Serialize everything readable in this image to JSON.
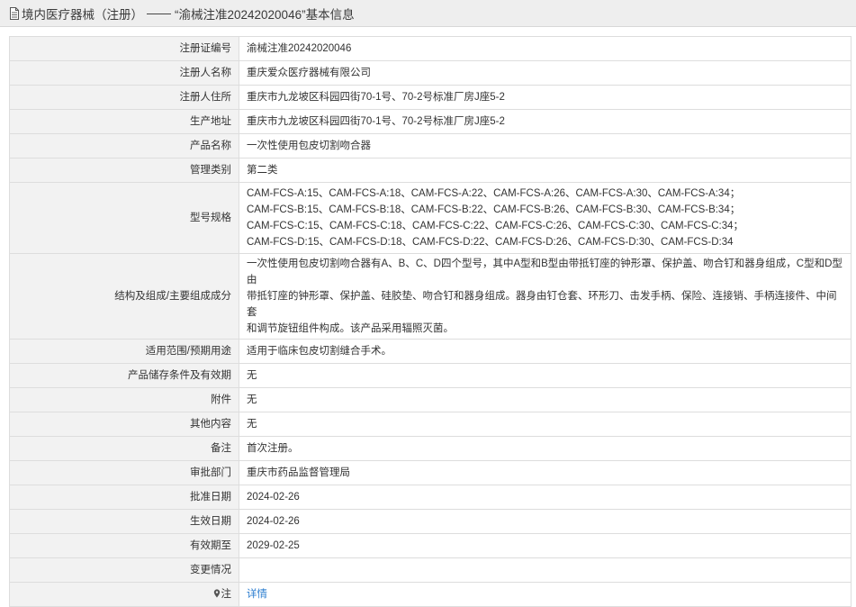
{
  "header": {
    "category": "境内医疗器械（注册）",
    "separator": "——",
    "title": "“渝械注准20242020046”基本信息"
  },
  "rows": [
    {
      "label": "注册证编号",
      "value": "渝械注准20242020046"
    },
    {
      "label": "注册人名称",
      "value": "重庆爱众医疗器械有限公司"
    },
    {
      "label": "注册人住所",
      "value": "重庆市九龙坡区科园四街70-1号、70-2号标准厂房J座5-2"
    },
    {
      "label": "生产地址",
      "value": "重庆市九龙坡区科园四街70-1号、70-2号标准厂房J座5-2"
    },
    {
      "label": "产品名称",
      "value": "一次性使用包皮切割吻合器"
    },
    {
      "label": "管理类别",
      "value": "第二类"
    }
  ],
  "model_row": {
    "label": "型号规格",
    "lines": [
      "CAM-FCS-A:15、CAM-FCS-A:18、CAM-FCS-A:22、CAM-FCS-A:26、CAM-FCS-A:30、CAM-FCS-A:34；",
      "CAM-FCS-B:15、CAM-FCS-B:18、CAM-FCS-B:22、CAM-FCS-B:26、CAM-FCS-B:30、CAM-FCS-B:34；",
      "CAM-FCS-C:15、CAM-FCS-C:18、CAM-FCS-C:22、CAM-FCS-C:26、CAM-FCS-C:30、CAM-FCS-C:34；",
      "CAM-FCS-D:15、CAM-FCS-D:18、CAM-FCS-D:22、CAM-FCS-D:26、CAM-FCS-D:30、CAM-FCS-D:34"
    ]
  },
  "structure_row": {
    "label": "结构及组成/主要组成成分",
    "lines": [
      "一次性使用包皮切割吻合器有A、B、C、D四个型号，其中A型和B型由带抵钉座的钟形罩、保护盖、吻合钉和器身组成，C型和D型由",
      "带抵钉座的钟形罩、保护盖、硅胶垫、吻合钉和器身组成。器身由钉仓套、环形刀、击发手柄、保险、连接销、手柄连接件、中间套",
      "和调节旋钮组件构成。该产品采用辐照灭菌。"
    ]
  },
  "rows2": [
    {
      "label": "适用范围/预期用途",
      "value": "适用于临床包皮切割缝合手术。"
    },
    {
      "label": "产品储存条件及有效期",
      "value": "无"
    },
    {
      "label": "附件",
      "value": "无"
    },
    {
      "label": "其他内容",
      "value": "无"
    },
    {
      "label": "备注",
      "value": "首次注册。"
    },
    {
      "label": "审批部门",
      "value": "重庆市药品监督管理局"
    },
    {
      "label": "批准日期",
      "value": "2024-02-26"
    },
    {
      "label": "生效日期",
      "value": "2024-02-26"
    },
    {
      "label": "有效期至",
      "value": "2029-02-25"
    },
    {
      "label": "变更情况",
      "value": ""
    }
  ],
  "note_row": {
    "label": "注",
    "link": "详情"
  },
  "colors": {
    "link": "#2a7ccf",
    "label_bg": "#f2f2f2",
    "border": "#dddddd"
  }
}
